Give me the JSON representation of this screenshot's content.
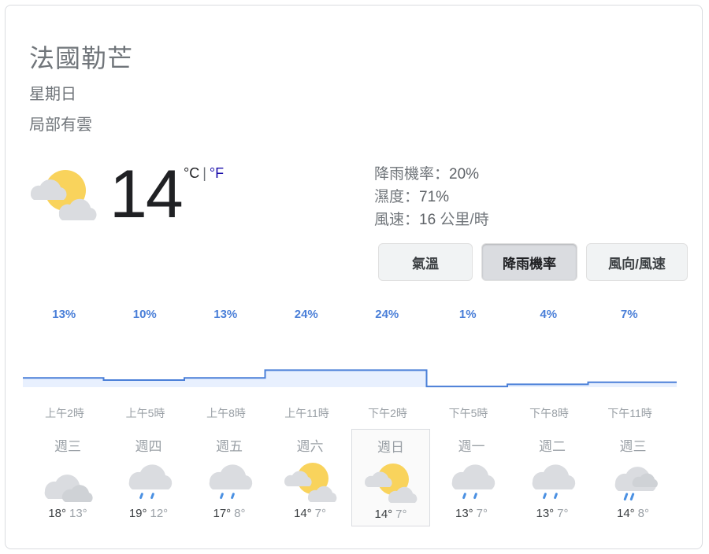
{
  "location": "法國勒芒",
  "day": "星期日",
  "condition": "局部有雲",
  "current": {
    "temperature": "14",
    "unit_c": "°C",
    "unit_sep": "|",
    "unit_f": "°F",
    "icon": "partly-cloudy-icon"
  },
  "stats": {
    "precip_label": "降雨機率：",
    "precip_value": "20%",
    "humidity_label": "濕度：",
    "humidity_value": "71%",
    "wind_label": "風速：",
    "wind_value": "16",
    "wind_unit": " 公里/時"
  },
  "tabs": [
    {
      "label": "氣溫",
      "active": false
    },
    {
      "label": "降雨機率",
      "active": true
    },
    {
      "label": "風向/風速",
      "active": false
    }
  ],
  "chart_data": {
    "type": "area",
    "title": "",
    "xlabel": "",
    "ylabel": "",
    "categories": [
      "上午2時",
      "上午5時",
      "上午8時",
      "上午11時",
      "下午2時",
      "下午5時",
      "下午8時",
      "下午11時"
    ],
    "labels": [
      "13%",
      "10%",
      "13%",
      "24%",
      "24%",
      "1%",
      "4%",
      "7%"
    ],
    "values": [
      13,
      10,
      13,
      24,
      24,
      1,
      4,
      7
    ],
    "ylim": [
      0,
      100
    ],
    "color": "#4a7fd8",
    "fill": "#e8f0fe"
  },
  "forecast": [
    {
      "day": "週三",
      "icon": "cloudy-icon",
      "hi": "18°",
      "lo": "13°"
    },
    {
      "day": "週四",
      "icon": "rain-icon",
      "hi": "19°",
      "lo": "12°"
    },
    {
      "day": "週五",
      "icon": "rain-icon",
      "hi": "17°",
      "lo": "8°"
    },
    {
      "day": "週六",
      "icon": "partly-cloudy-icon",
      "hi": "14°",
      "lo": "7°"
    },
    {
      "day": "週日",
      "icon": "partly-cloudy-icon",
      "hi": "14°",
      "lo": "7°",
      "selected": true
    },
    {
      "day": "週一",
      "icon": "rain-icon",
      "hi": "13°",
      "lo": "7°"
    },
    {
      "day": "週二",
      "icon": "rain-icon",
      "hi": "13°",
      "lo": "7°"
    },
    {
      "day": "週三",
      "icon": "showers-icon",
      "hi": "14°",
      "lo": "8°"
    }
  ],
  "colors": {
    "accent": "#4a7fd8",
    "sun": "#f9d35c",
    "cloud": "#dadce0",
    "rain": "#4a90e2"
  }
}
